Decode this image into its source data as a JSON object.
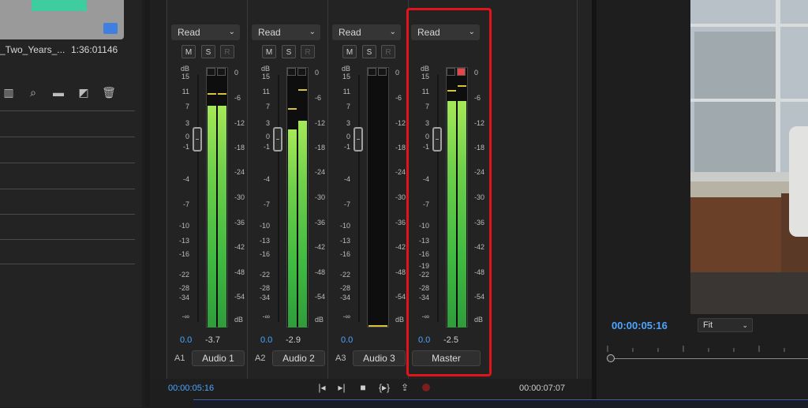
{
  "project_panel": {
    "clip_name": "_Two_Years_...",
    "clip_duration": "1:36:01146",
    "toolbar_icons": [
      "grid-view-icon",
      "search-icon",
      "folder-icon",
      "new-item-icon",
      "trash-icon"
    ]
  },
  "mixer": {
    "left_scale": [
      "dB",
      "15",
      "11",
      "7",
      "3",
      "0",
      "-1",
      "-4",
      "-7",
      "-10",
      "-13",
      "-16",
      "-22",
      "-28",
      "-34",
      "-∞"
    ],
    "meter_scale": [
      "0",
      "-6",
      "-12",
      "-18",
      "-24",
      "-30",
      "-36",
      "-42",
      "-48",
      "-54",
      "dB"
    ],
    "master_left_scale": [
      "dB",
      "15",
      "11",
      "7",
      "3",
      "0",
      "-1",
      "-4",
      "-7",
      "-10",
      "-13",
      "-16",
      "-19",
      "-22",
      "-28",
      "-34",
      "-∞"
    ],
    "buttons": {
      "m": "M",
      "s": "S",
      "r": "R"
    },
    "channels": [
      {
        "automation": "Read",
        "pan": "0.0",
        "volume": "-3.7",
        "track_id": "A1",
        "name": "Audio 1",
        "level_db": -3.7
      },
      {
        "automation": "Read",
        "pan": "0.0",
        "volume": "-2.9",
        "track_id": "A2",
        "name": "Audio 2",
        "level_db": -2.9
      },
      {
        "automation": "Read",
        "pan": "0.0",
        "volume": "",
        "track_id": "A3",
        "name": "Audio 3",
        "level_db": null
      },
      {
        "automation": "Read",
        "pan": "0.0",
        "volume": "-2.5",
        "track_id": "",
        "name": "Master",
        "level_db": -2.5
      }
    ],
    "timecode_current": "00:00:05:16",
    "timecode_end": "00:00:07:07",
    "controls": [
      "go-to-in-icon",
      "go-to-out-icon",
      "stop-icon",
      "loop-icon",
      "export-icon",
      "record-icon"
    ]
  },
  "monitor": {
    "timecode": "00:00:05:16",
    "zoom": "Fit"
  }
}
